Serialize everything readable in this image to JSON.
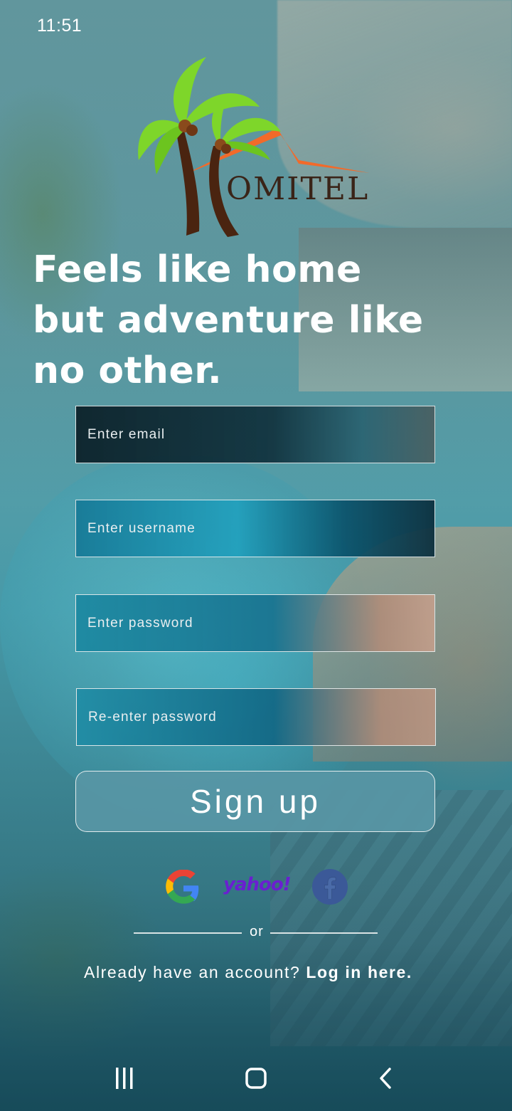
{
  "status_bar": {
    "time": "11:51"
  },
  "brand": {
    "logo_text": "OMITEL"
  },
  "tagline": {
    "line1": "Feels like home",
    "line2": "but adventure like",
    "line3": "no other."
  },
  "form": {
    "email_placeholder": "Enter email",
    "username_placeholder": "Enter username",
    "password_placeholder": "Enter password",
    "reenter_password_placeholder": "Re-enter password",
    "signup_label": "Sign up"
  },
  "social": {
    "providers": [
      "google-icon",
      "yahoo-logo",
      "facebook-icon"
    ],
    "yahoo_text": "yahoo!"
  },
  "divider": {
    "or_text": "or"
  },
  "login": {
    "prompt": "Already have an account?",
    "link_text": "Log in here."
  },
  "colors": {
    "signup_bg": "#5896a5",
    "text": "#ffffff",
    "yahoo": "#6a1fd0",
    "facebook": "#3b5998",
    "logo_roof": "#f26a2a",
    "palm_leaves": "#7ed62a",
    "palm_trunk": "#4a2410"
  },
  "nav_bar": {
    "buttons": [
      "recent-apps-icon",
      "home-icon",
      "back-icon"
    ]
  }
}
